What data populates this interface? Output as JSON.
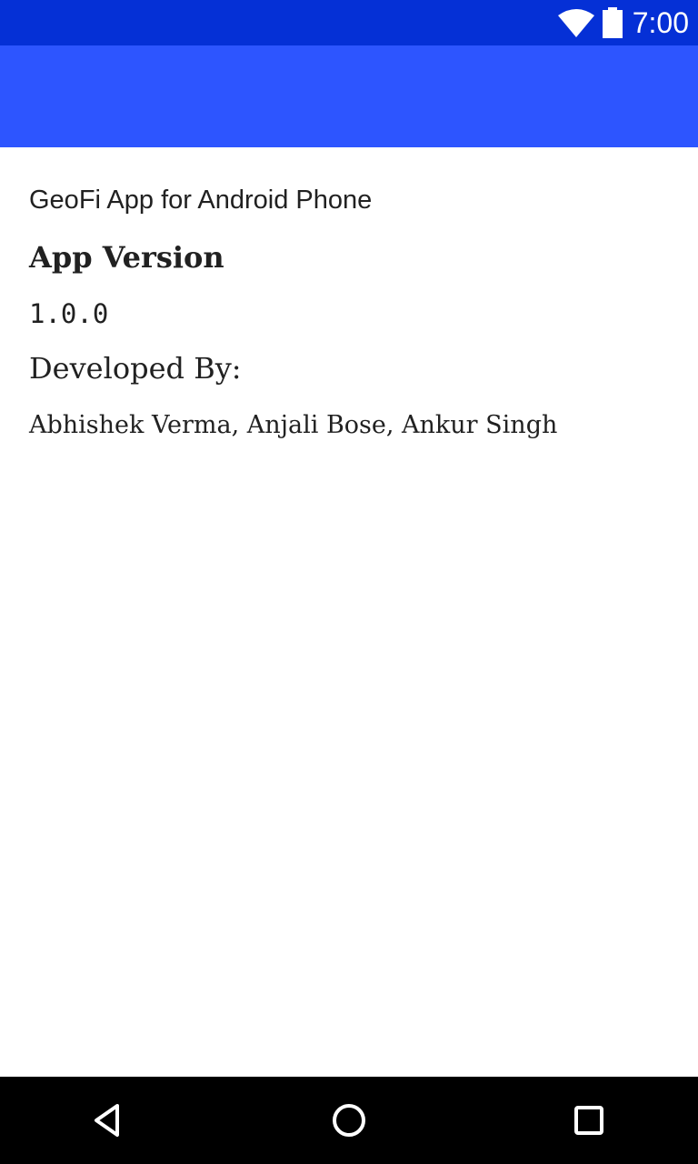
{
  "status_bar": {
    "time": "7:00",
    "wifi_icon": "wifi-icon",
    "battery_icon": "battery-icon",
    "background": "#0530d6"
  },
  "app_bar": {
    "background": "#2d55ff"
  },
  "about": {
    "app_name": "GeoFi App for Android Phone",
    "version_label": "App Version",
    "version_value": "1.0.0",
    "developed_label": "Developed By:",
    "developers": "Abhishek Verma, Anjali Bose, Ankur Singh"
  },
  "nav_bar": {
    "back_icon": "back-icon",
    "home_icon": "home-icon",
    "recents_icon": "recents-icon"
  }
}
